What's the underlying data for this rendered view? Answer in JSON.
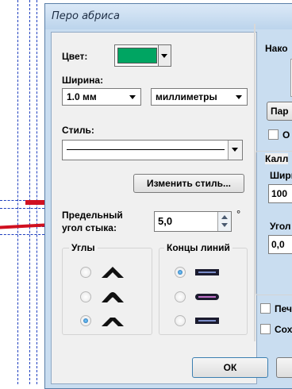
{
  "window": {
    "title": "Перо абриса"
  },
  "color": {
    "label": "Цвет:",
    "swatch_color": "#00a562"
  },
  "width": {
    "label": "Ширина:",
    "value": "1.0 мм",
    "units": "миллиметры"
  },
  "style": {
    "label": "Стиль:",
    "edit_button": "Изменить стиль..."
  },
  "miter": {
    "label_line1": "Предельный",
    "label_line2": "угол стыка:",
    "value": "5,0",
    "degree_sign": "°"
  },
  "corners": {
    "title": "Углы",
    "options": [
      "miter",
      "round",
      "bevel"
    ],
    "selected": 2
  },
  "line_caps": {
    "title": "Концы линий",
    "options": [
      "butt",
      "round",
      "square"
    ],
    "selected": 0
  },
  "right_panel": {
    "top_label": "Нако",
    "params_button": "Пар",
    "checkbox1_label": "О",
    "calligraphy_label": "Калл",
    "width_label": "Шири",
    "width_value": "100",
    "angle_label": "Угол",
    "angle_value": "0,0",
    "print_label": "Печ",
    "save_label": "Сох"
  },
  "footer": {
    "ok_button": "ОК"
  }
}
